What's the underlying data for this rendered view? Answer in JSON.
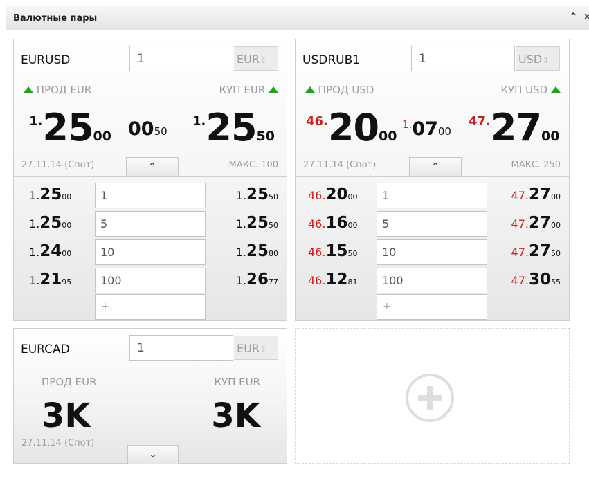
{
  "window": {
    "title": "Валютные пары",
    "collapse_icon": "^",
    "close_icon": "×"
  },
  "colors": {
    "buy_arrow": "#1fa31f",
    "ruble_prefix": "#cc1f1f"
  },
  "tiles": [
    {
      "symbol": "EURUSD",
      "qty": "1",
      "currency": "EUR",
      "currency_toggle": "⇕",
      "sell_label": "ПРОД EUR",
      "buy_label": "КУП EUR",
      "sell_pre": "1.",
      "sell_main": "25",
      "sell_pip": "00",
      "spread_pre": "",
      "spread_big": "00",
      "spread_small": "50",
      "buy_pre": "1.",
      "buy_main": "25",
      "buy_pip": "50",
      "date": "27.11.14 (Спот)",
      "max": "МАКС. 100",
      "ladder": [
        {
          "bid_pre": "1.",
          "bid_main": "25",
          "bid_pip": "00",
          "qty": "1",
          "ask_pre": "1.",
          "ask_main": "25",
          "ask_pip": "50"
        },
        {
          "bid_pre": "1.",
          "bid_main": "25",
          "bid_pip": "00",
          "qty": "5",
          "ask_pre": "1.",
          "ask_main": "25",
          "ask_pip": "50"
        },
        {
          "bid_pre": "1.",
          "bid_main": "24",
          "bid_pip": "00",
          "qty": "10",
          "ask_pre": "1.",
          "ask_main": "25",
          "ask_pip": "80"
        },
        {
          "bid_pre": "1.",
          "bid_main": "21",
          "bid_pip": "95",
          "qty": "100",
          "ask_pre": "1.",
          "ask_main": "26",
          "ask_pip": "77"
        }
      ],
      "add_placeholder": "+"
    },
    {
      "symbol": "USDRUB1",
      "qty": "1",
      "currency": "USD",
      "currency_toggle": "⇕",
      "sell_label": "ПРОД USD",
      "buy_label": "КУП USD",
      "sell_pre": "46.",
      "sell_main": "20",
      "sell_pip": "00",
      "spread_pre": "1.",
      "spread_big": "07",
      "spread_small": "00",
      "buy_pre": "47.",
      "buy_main": "27",
      "buy_pip": "00",
      "date": "27.11.14 (Спот)",
      "max": "МАКС. 250",
      "ladder": [
        {
          "bid_pre": "46.",
          "bid_main": "20",
          "bid_pip": "00",
          "qty": "1",
          "ask_pre": "47.",
          "ask_main": "27",
          "ask_pip": "00"
        },
        {
          "bid_pre": "46.",
          "bid_main": "16",
          "bid_pip": "00",
          "qty": "5",
          "ask_pre": "47.",
          "ask_main": "27",
          "ask_pip": "00"
        },
        {
          "bid_pre": "46.",
          "bid_main": "15",
          "bid_pip": "50",
          "qty": "10",
          "ask_pre": "47.",
          "ask_main": "27",
          "ask_pip": "50"
        },
        {
          "bid_pre": "46.",
          "bid_main": "12",
          "bid_pip": "81",
          "qty": "100",
          "ask_pre": "47.",
          "ask_main": "30",
          "ask_pip": "55"
        }
      ],
      "add_placeholder": "+"
    },
    {
      "symbol": "EURCAD",
      "qty": "1",
      "currency": "EUR",
      "currency_toggle": "⇕",
      "sell_label": "ПРОД EUR",
      "buy_label": "КУП EUR",
      "sell_value": "3K",
      "buy_value": "3K",
      "date": "27.11.14 (Спот)"
    }
  ],
  "add_tile_icon": "plus-circle-icon"
}
